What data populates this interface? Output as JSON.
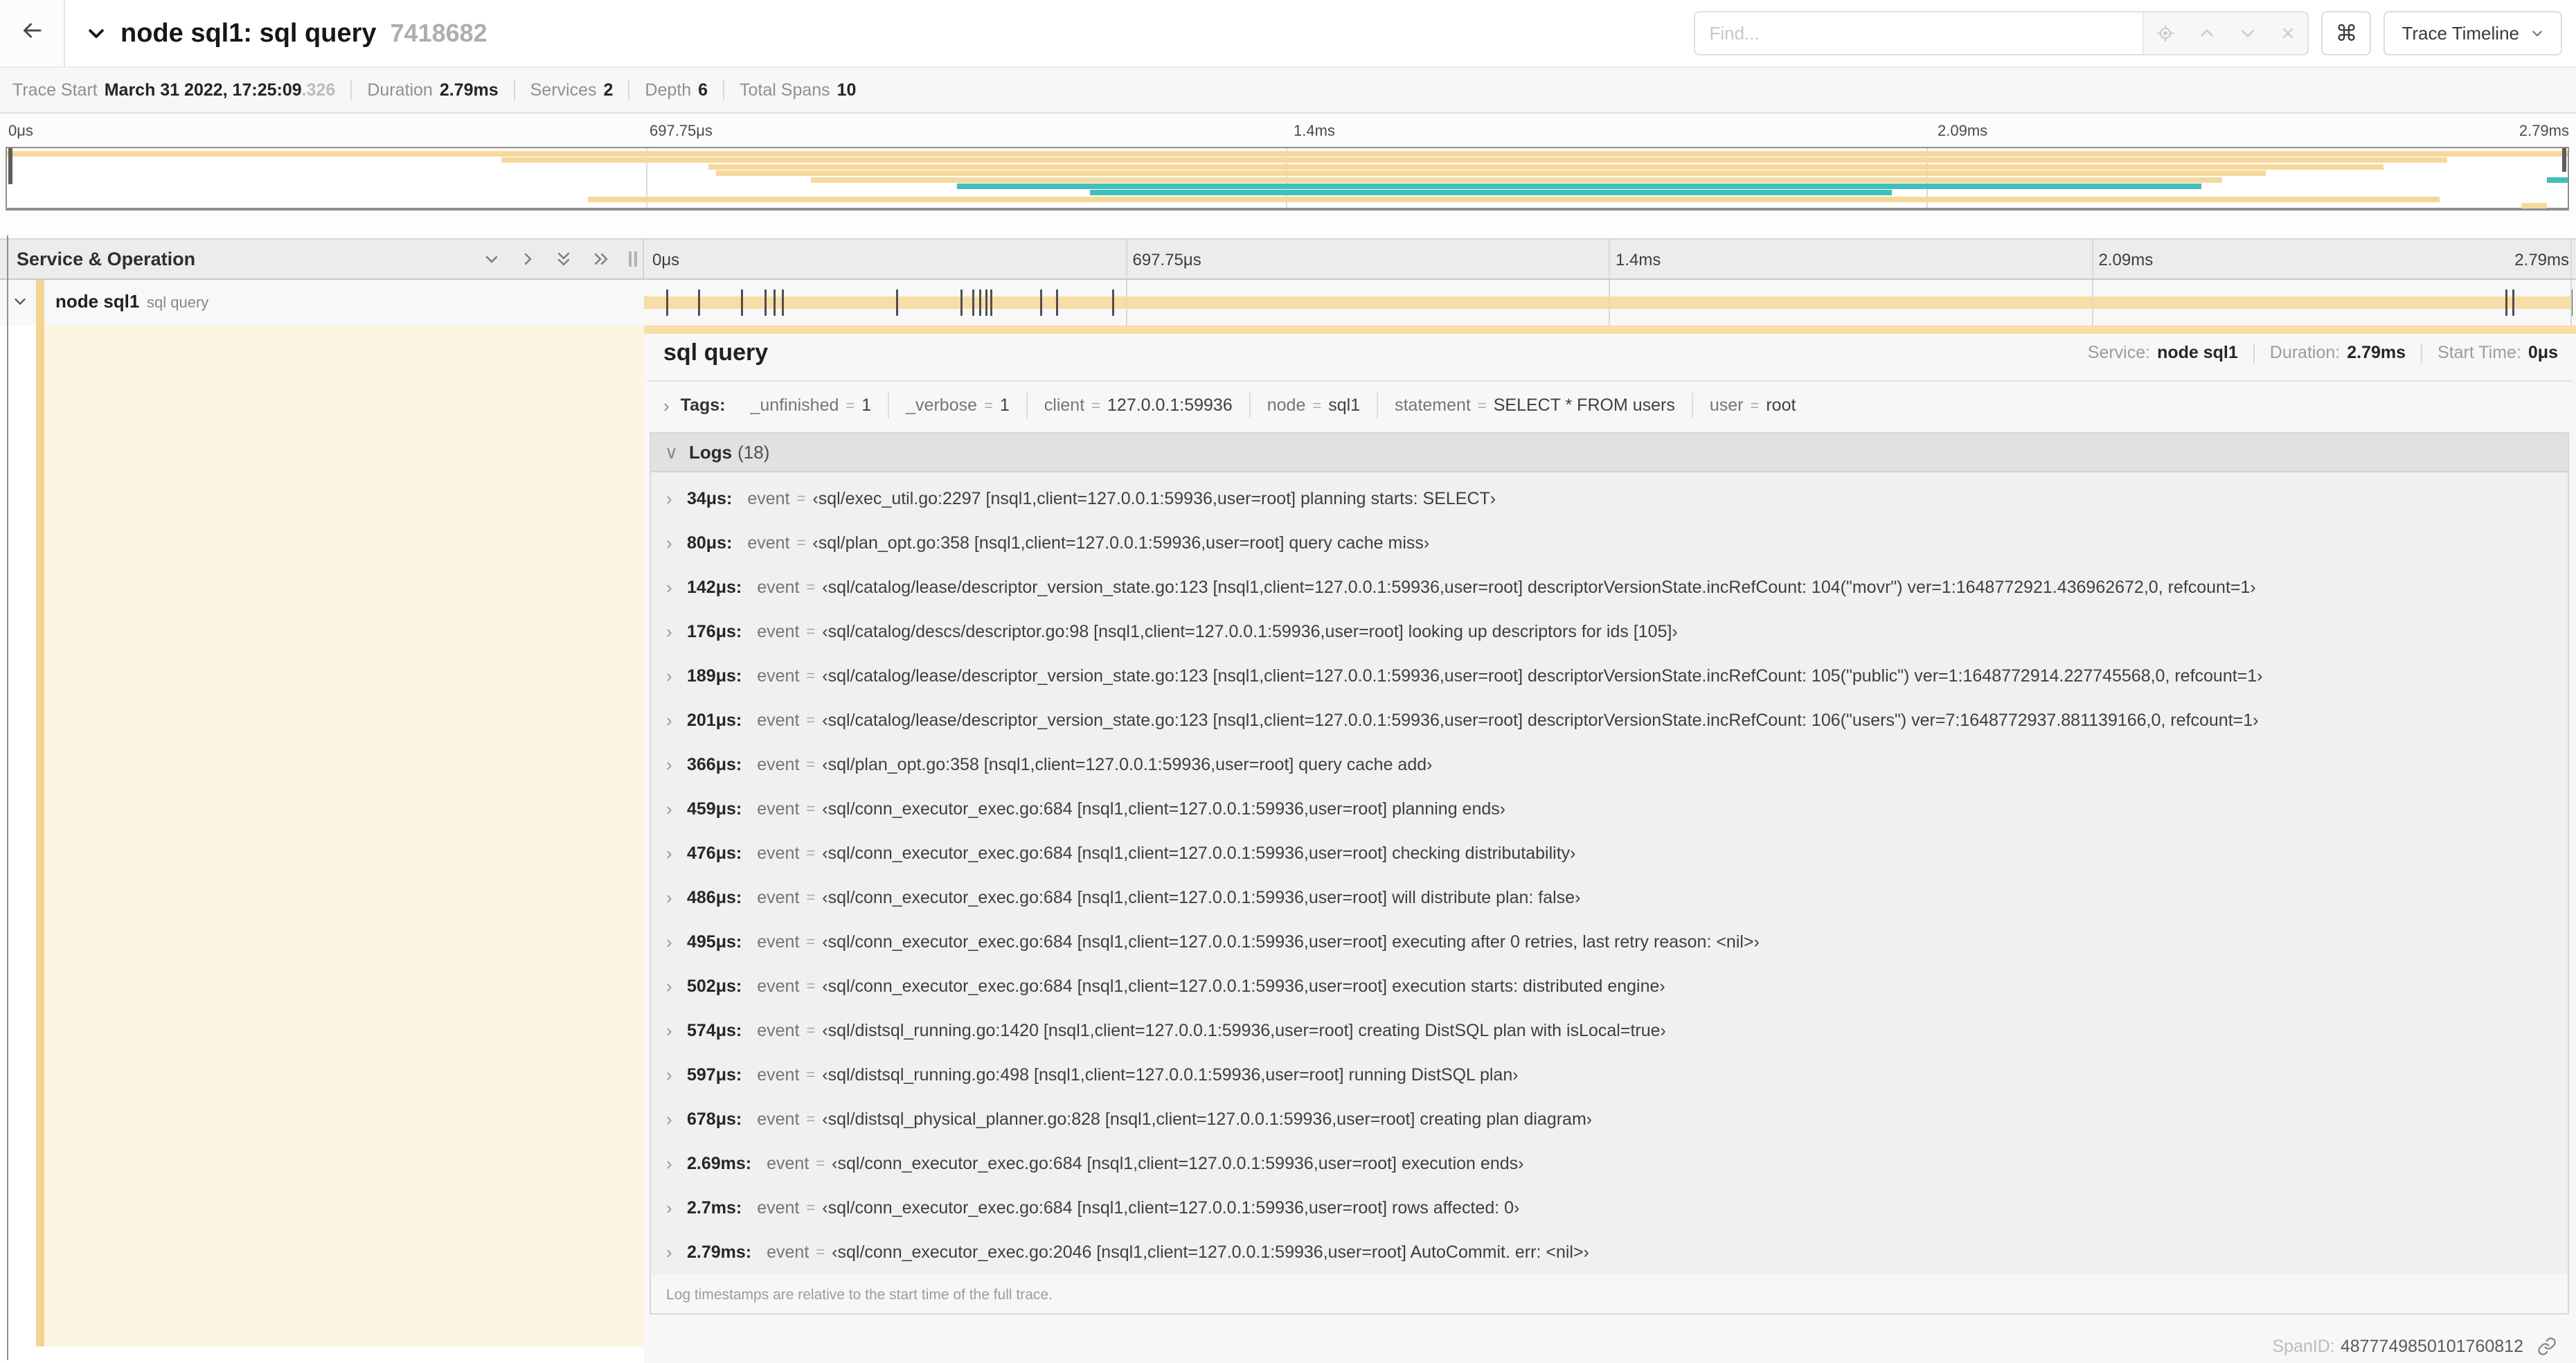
{
  "header": {
    "title": "node sql1: sql query",
    "trace_id_suffix": "7418682",
    "find_placeholder": "Find...",
    "kbd_button_label": "⌘",
    "view_dropdown_label": "Trace Timeline"
  },
  "trace_stats": {
    "items": [
      {
        "label": "Trace Start",
        "value": "March 31 2022, 17:25:09",
        "suffix": ".326"
      },
      {
        "label": "Duration",
        "value": "2.79ms",
        "suffix": ""
      },
      {
        "label": "Services",
        "value": "2",
        "suffix": ""
      },
      {
        "label": "Depth",
        "value": "6",
        "suffix": ""
      },
      {
        "label": "Total Spans",
        "value": "10",
        "suffix": ""
      }
    ]
  },
  "timeline": {
    "ticks": [
      "0μs",
      "697.75μs",
      "1.4ms",
      "2.09ms",
      "2.79ms"
    ],
    "duration_us": 2790
  },
  "minimap": {
    "rows": [
      [
        {
          "color": "tan",
          "start": 0,
          "end": 100
        }
      ],
      [
        {
          "color": "tan",
          "start": 19.3,
          "end": 95.3
        }
      ],
      [
        {
          "color": "tan",
          "start": 27.4,
          "end": 92.8
        }
      ],
      [
        {
          "color": "tan",
          "start": 27.7,
          "end": 88.2
        }
      ],
      [
        {
          "color": "tan",
          "start": 31.4,
          "end": 86.5
        },
        {
          "color": "teal",
          "start": 99.2,
          "end": 100
        }
      ],
      [
        {
          "color": "teal",
          "start": 37.1,
          "end": 85.7
        }
      ],
      [
        {
          "color": "teal",
          "start": 42.3,
          "end": 73.6
        }
      ],
      [
        {
          "color": "tan",
          "start": 22.7,
          "end": 95.0
        }
      ],
      [
        {
          "color": "tan",
          "start": 98.2,
          "end": 99.2
        }
      ]
    ],
    "colors": {
      "tan": "#f5d99c",
      "teal": "#41bfba"
    }
  },
  "grid": {
    "name_column_title": "Service & Operation"
  },
  "span_row": {
    "service": "node sql1",
    "operation": "sql query"
  },
  "detail": {
    "title": "sql query",
    "meta": {
      "service_label": "Service:",
      "service_value": "node sql1",
      "duration_label": "Duration:",
      "duration_value": "2.79ms",
      "start_label": "Start Time:",
      "start_value": "0μs"
    }
  },
  "tags": {
    "label": "Tags:",
    "items": [
      {
        "key": "_unfinished",
        "value": "1"
      },
      {
        "key": "_verbose",
        "value": "1"
      },
      {
        "key": "client",
        "value": "127.0.0.1:59936"
      },
      {
        "key": "node",
        "value": "sql1"
      },
      {
        "key": "statement",
        "value": "SELECT * FROM users"
      },
      {
        "key": "user",
        "value": "root"
      }
    ]
  },
  "logs": {
    "label": "Logs",
    "count": "(18)",
    "note": "Log timestamps are relative to the start time of the full trace.",
    "rows": [
      {
        "time": "34μs:",
        "t_us": 34,
        "field": "event",
        "value": "‹sql/exec_util.go:2297 [nsql1,client=127.0.0.1:59936,user=root] planning starts: SELECT›"
      },
      {
        "time": "80μs:",
        "t_us": 80,
        "field": "event",
        "value": "‹sql/plan_opt.go:358 [nsql1,client=127.0.0.1:59936,user=root] query cache miss›"
      },
      {
        "time": "142μs:",
        "t_us": 142,
        "field": "event",
        "value": "‹sql/catalog/lease/descriptor_version_state.go:123 [nsql1,client=127.0.0.1:59936,user=root] descriptorVersionState.incRefCount: 104(\"movr\") ver=1:1648772921.436962672,0, refcount=1›"
      },
      {
        "time": "176μs:",
        "t_us": 176,
        "field": "event",
        "value": "‹sql/catalog/descs/descriptor.go:98 [nsql1,client=127.0.0.1:59936,user=root] looking up descriptors for ids [105]›"
      },
      {
        "time": "189μs:",
        "t_us": 189,
        "field": "event",
        "value": "‹sql/catalog/lease/descriptor_version_state.go:123 [nsql1,client=127.0.0.1:59936,user=root] descriptorVersionState.incRefCount: 105(\"public\") ver=1:1648772914.227745568,0, refcount=1›"
      },
      {
        "time": "201μs:",
        "t_us": 201,
        "field": "event",
        "value": "‹sql/catalog/lease/descriptor_version_state.go:123 [nsql1,client=127.0.0.1:59936,user=root] descriptorVersionState.incRefCount: 106(\"users\") ver=7:1648772937.881139166,0, refcount=1›"
      },
      {
        "time": "366μs:",
        "t_us": 366,
        "field": "event",
        "value": "‹sql/plan_opt.go:358 [nsql1,client=127.0.0.1:59936,user=root] query cache add›"
      },
      {
        "time": "459μs:",
        "t_us": 459,
        "field": "event",
        "value": "‹sql/conn_executor_exec.go:684 [nsql1,client=127.0.0.1:59936,user=root] planning ends›"
      },
      {
        "time": "476μs:",
        "t_us": 476,
        "field": "event",
        "value": "‹sql/conn_executor_exec.go:684 [nsql1,client=127.0.0.1:59936,user=root] checking distributability›"
      },
      {
        "time": "486μs:",
        "t_us": 486,
        "field": "event",
        "value": "‹sql/conn_executor_exec.go:684 [nsql1,client=127.0.0.1:59936,user=root] will distribute plan: false›"
      },
      {
        "time": "495μs:",
        "t_us": 495,
        "field": "event",
        "value": "‹sql/conn_executor_exec.go:684 [nsql1,client=127.0.0.1:59936,user=root] executing after 0 retries, last retry reason: <nil>›"
      },
      {
        "time": "502μs:",
        "t_us": 502,
        "field": "event",
        "value": "‹sql/conn_executor_exec.go:684 [nsql1,client=127.0.0.1:59936,user=root] execution starts: distributed engine›"
      },
      {
        "time": "574μs:",
        "t_us": 574,
        "field": "event",
        "value": "‹sql/distsql_running.go:1420 [nsql1,client=127.0.0.1:59936,user=root] creating DistSQL plan with isLocal=true›"
      },
      {
        "time": "597μs:",
        "t_us": 597,
        "field": "event",
        "value": "‹sql/distsql_running.go:498 [nsql1,client=127.0.0.1:59936,user=root] running DistSQL plan›"
      },
      {
        "time": "678μs:",
        "t_us": 678,
        "field": "event",
        "value": "‹sql/distsql_physical_planner.go:828 [nsql1,client=127.0.0.1:59936,user=root] creating plan diagram›"
      },
      {
        "time": "2.69ms:",
        "t_us": 2690,
        "field": "event",
        "value": "‹sql/conn_executor_exec.go:684 [nsql1,client=127.0.0.1:59936,user=root] execution ends›"
      },
      {
        "time": "2.7ms:",
        "t_us": 2700,
        "field": "event",
        "value": "‹sql/conn_executor_exec.go:684 [nsql1,client=127.0.0.1:59936,user=root] rows affected: 0›"
      },
      {
        "time": "2.79ms:",
        "t_us": 2790,
        "field": "event",
        "value": "‹sql/conn_executor_exec.go:2046 [nsql1,client=127.0.0.1:59936,user=root] AutoCommit. err: <nil>›"
      }
    ]
  },
  "footer": {
    "spanid_label": "SpanID:",
    "spanid_value": "4877749850101760812"
  }
}
